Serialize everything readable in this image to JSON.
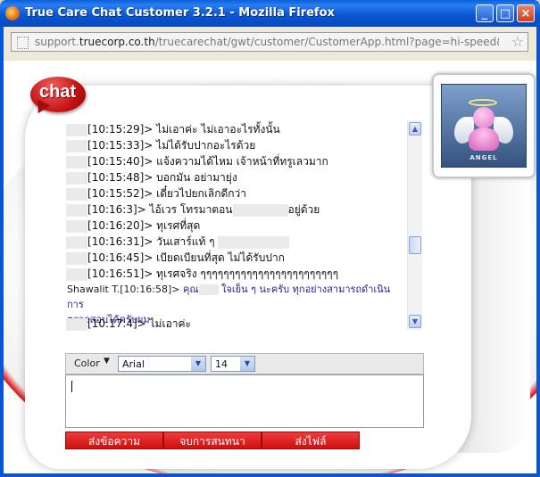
{
  "window": {
    "title": "True Care Chat Customer 3.2.1 - Mozilla Firefox",
    "controls": [
      "_",
      "□",
      "×"
    ]
  },
  "address_bar": {
    "url_prefix": "support.",
    "url_domain": "truecorp.co.th",
    "url_path": "/truecarechat/gwt/customer/CustomerApp.html?page=hi-speed&lanc"
  },
  "brand": {
    "logo_text": "chat"
  },
  "avatar": {
    "label": "ANGEL"
  },
  "transcript": {
    "messages": [
      {
        "time": "10:15:29",
        "text": "ไม่เอาค่ะ ไม่เอาอะไรทั้งนั้น"
      },
      {
        "time": "10:15:33",
        "text": "ไม่ได้รับปากอะไรด้วย"
      },
      {
        "time": "10:15:40",
        "text": "แจ้งความได้ไหม เจ้าหน้าที่ทรูเลวมาก"
      },
      {
        "time": "10:15:48",
        "text": "บอกมัน อย่ามายุ่ง"
      },
      {
        "time": "10:15:52",
        "text": "เดี๋ยวไปยกเลิกดีกว่า"
      },
      {
        "time": "10:16:3",
        "text": "ไอ้เวร โทรมาตอน",
        "text_after": "อยู่ด้วย"
      },
      {
        "time": "10:16:20",
        "text": "ทุเรศที่สุด"
      },
      {
        "time": "10:16:31",
        "text": "วันเสาร์แท้ ๆ"
      },
      {
        "time": "10:16:45",
        "text": "เบียดเบียนที่สุด ไม่ได้รับปาก"
      },
      {
        "time": "10:16:51",
        "text": "ทุเรศจริง ๆๆๆๆๆๆๆๆๆๆๆๆๆๆๆๆๆๆๆๆๆๆๆๆ"
      }
    ],
    "agent_message": {
      "name": "Shawalit T.[10:16:58]>",
      "text_before": "คุณ",
      "text_line1": "ใจเย็น ๆ นะครับ ทุกอย่างสามารถดำเนินการ",
      "text_line2": "ตรวจสอบได้ครับผม"
    },
    "last_message": {
      "time": "10:17:4",
      "text": "ไม่เอาค่ะ"
    }
  },
  "toolbar": {
    "color_label": "Color",
    "font_value": "Arial",
    "size_value": "14"
  },
  "compose": {
    "value": ""
  },
  "actions": {
    "send_label": "ส่งข้อความ",
    "end_label": "จบการสนทนา",
    "file_label": "ส่งไฟล์"
  },
  "colors": {
    "accent_red": "#d21414",
    "titlebar_blue": "#0a58d0"
  }
}
